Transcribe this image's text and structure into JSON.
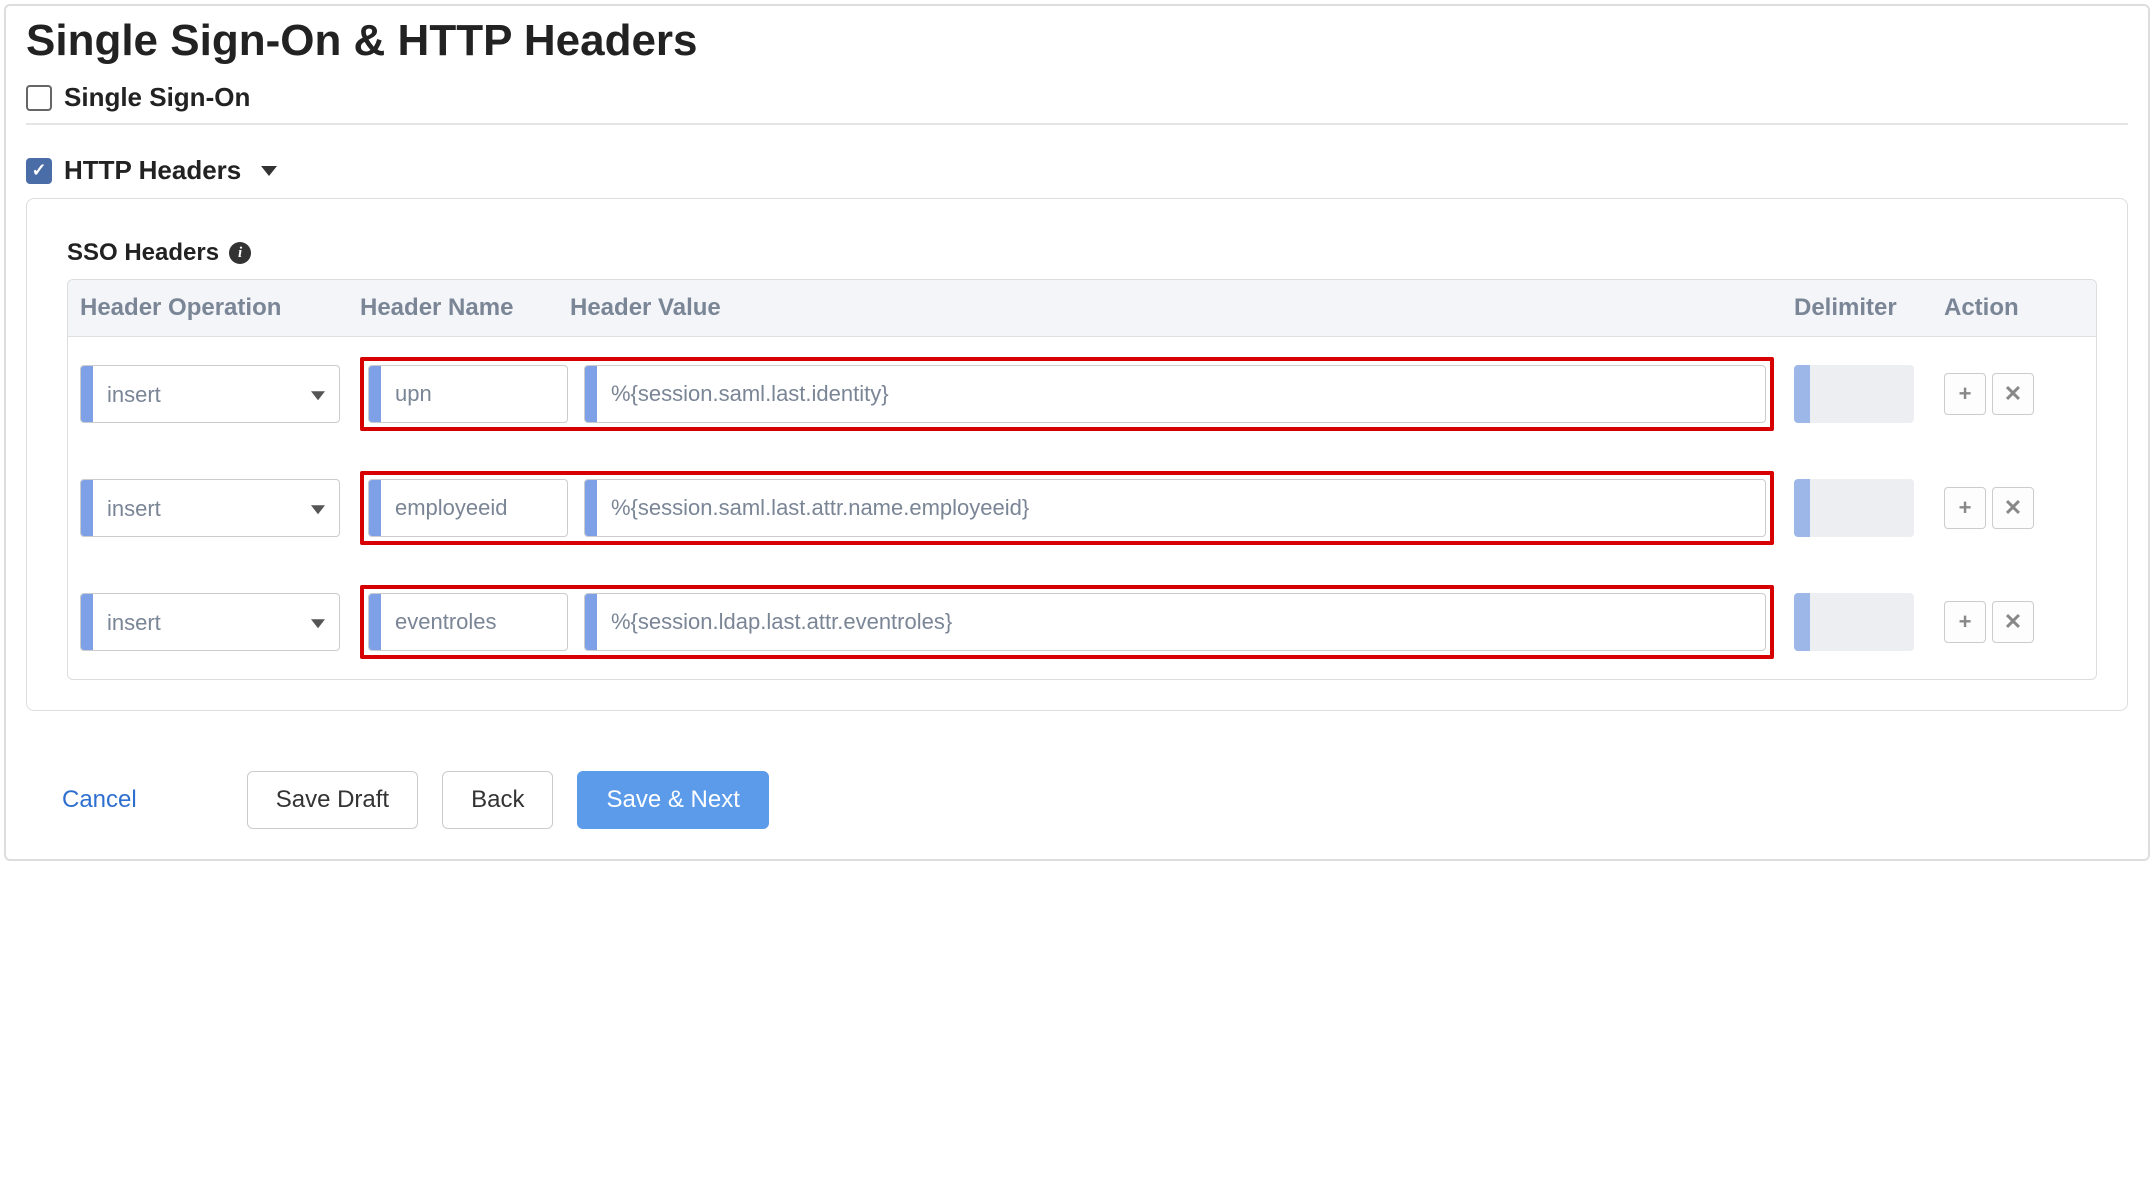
{
  "page": {
    "title": "Single Sign-On & HTTP Headers"
  },
  "sections": {
    "sso": {
      "label": "Single Sign-On",
      "checked": false
    },
    "http_headers": {
      "label": "HTTP Headers",
      "checked": true
    }
  },
  "sso_headers": {
    "heading": "SSO Headers",
    "columns": {
      "operation": "Header Operation",
      "name": "Header Name",
      "value": "Header Value",
      "delimiter": "Delimiter",
      "action": "Action"
    },
    "rows": [
      {
        "operation": "insert",
        "name": "upn",
        "value": "%{session.saml.last.identity}",
        "delimiter": ""
      },
      {
        "operation": "insert",
        "name": "employeeid",
        "value": "%{session.saml.last.attr.name.employeeid}",
        "delimiter": ""
      },
      {
        "operation": "insert",
        "name": "eventroles",
        "value": "%{session.ldap.last.attr.eventroles}",
        "delimiter": ""
      }
    ]
  },
  "buttons": {
    "cancel": "Cancel",
    "save_draft": "Save Draft",
    "back": "Back",
    "save_next": "Save & Next"
  },
  "icons": {
    "add": "+",
    "remove": "✕",
    "info": "i"
  }
}
